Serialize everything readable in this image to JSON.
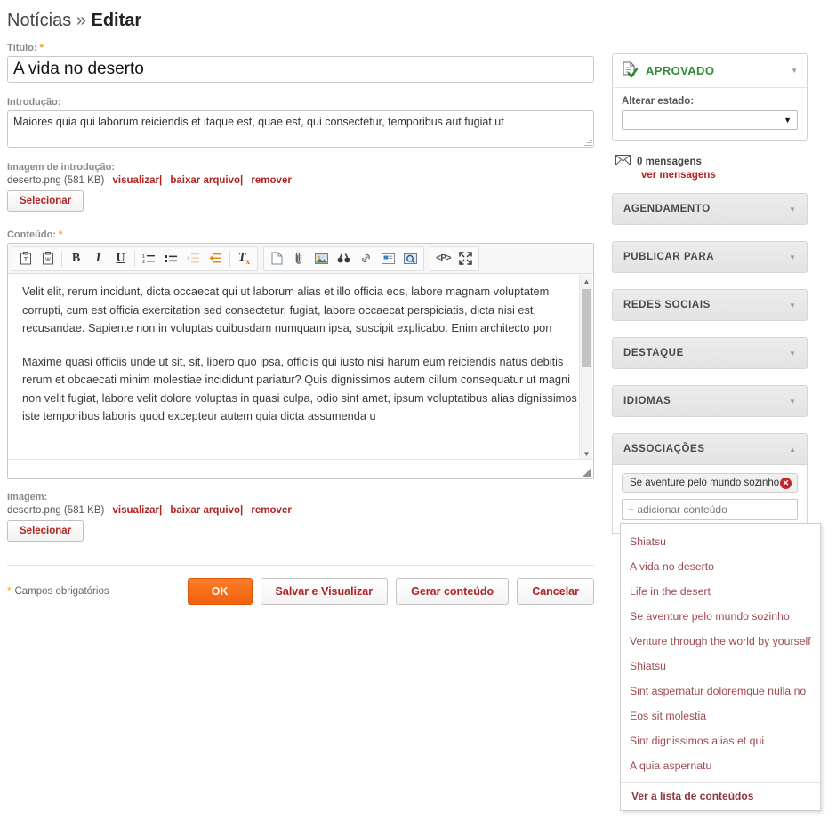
{
  "header": {
    "section": "Notícias",
    "separator": "»",
    "current": "Editar"
  },
  "form": {
    "title_label": "Título:",
    "title_value": "A vida no deserto",
    "intro_label": "Introdução:",
    "intro_value": "Maiores quia qui laborum reiciendis et itaque est, quae est, qui consectetur, temporibus aut fugiat ut",
    "intro_image_label": "Imagem de introdução:",
    "image_label": "Imagem:",
    "file_name": "deserto.png (581 KB)",
    "link_view": "visualizar",
    "link_download": "baixar arquivo",
    "link_remove": "remover",
    "pipe": "|",
    "select_button": "Selecionar",
    "content_label": "Conteúdo:",
    "required_mark": "*"
  },
  "toolbar": {
    "group1": [
      {
        "name": "paste-text-icon",
        "glyph": "T"
      },
      {
        "name": "paste-word-icon",
        "glyph": "W"
      }
    ],
    "bold": "B",
    "italic": "I",
    "underline": "U",
    "remove_format": "T",
    "remove_format_sub": "x",
    "source_label": "<P>"
  },
  "editor": {
    "paragraphs": [
      "Velit elit, rerum incidunt, dicta occaecat qui ut laborum alias et illo officia eos, labore magnam voluptatem corrupti, cum est officia exercitation sed consectetur, fugiat, labore occaecat perspiciatis, dicta nisi est, recusandae. Sapiente non in voluptas quibusdam numquam ipsa, suscipit explicabo. Enim architecto porr",
      "Maxime quasi officiis unde ut sit, sit, libero quo ipsa, officiis qui iusto nisi harum eum reiciendis natus debitis rerum et obcaecati minim molestiae incididunt pariatur? Quis dignissimos autem cillum consequatur ut magni non velit fugiat, labore velit dolore voluptas in quasi culpa, odio sint amet, ipsum voluptatibus alias dignissimos iste temporibus laboris quod excepteur autem quia dicta assumenda u"
    ]
  },
  "actions": {
    "required_note": "Campos obrigatórios",
    "required_star": "*",
    "ok": "OK",
    "save_preview": "Salvar e Visualizar",
    "generate": "Gerar conteúdo",
    "cancel": "Cancelar"
  },
  "sidebar": {
    "status": {
      "label": "APROVADO",
      "change_label": "Alterar estado:",
      "select_value": "",
      "color": "#2e8b33"
    },
    "messages": {
      "count_label": "0 mensagens",
      "link": "ver mensagens"
    },
    "sections": [
      {
        "label": "AGENDAMENTO",
        "expanded": false
      },
      {
        "label": "PUBLICAR PARA",
        "expanded": false
      },
      {
        "label": "REDES SOCIAIS",
        "expanded": false
      },
      {
        "label": "DESTAQUE",
        "expanded": false
      },
      {
        "label": "IDIOMAS",
        "expanded": false
      },
      {
        "label": "ASSOCIAÇÕES",
        "expanded": true
      }
    ],
    "associations": {
      "chip": "Se aventure pelo mundo sozinho",
      "chip_remove": "✕",
      "add_placeholder": "+ adicionar conteúdo"
    }
  },
  "dropdown": {
    "items": [
      "Shiatsu",
      "A vida no deserto",
      "Life in the desert",
      "Se aventure pelo mundo sozinho",
      "Venture through the world by yourself",
      "Shiatsu",
      "Sint aspernatur doloremque nulla no",
      "Eos sit molestia",
      "Sint dignissimos alias et qui",
      "A quia aspernatu"
    ],
    "footer": "Ver a lista de conteúdos"
  },
  "colors": {
    "accent_orange": "#f2610d",
    "link_red": "#b22222",
    "approved_green": "#2e8b33",
    "required_star": "#f0a030"
  }
}
